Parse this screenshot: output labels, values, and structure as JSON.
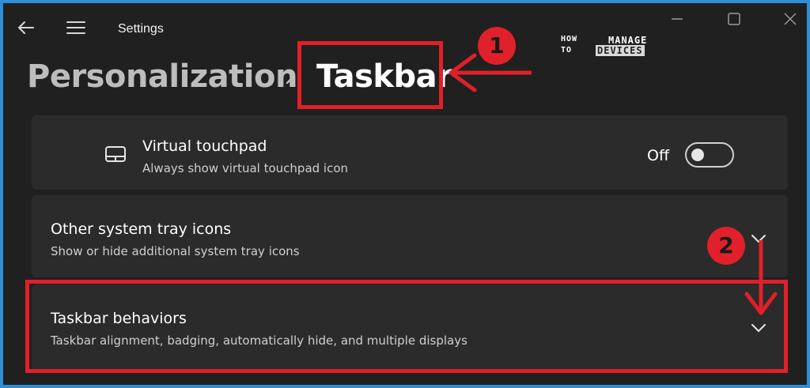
{
  "window": {
    "app_title": "Settings",
    "controls": [
      "minimize-icon",
      "maximize-icon",
      "close-icon"
    ]
  },
  "logo": {
    "how": "HOW",
    "to": "TO",
    "manage": "MANAGE",
    "devices": "DEVICES"
  },
  "breadcrumb": {
    "parent": "Personalization",
    "separator_icon": "chevron-right-icon",
    "current": "Taskbar"
  },
  "cards": {
    "virtual_touchpad": {
      "icon": "touchpad-icon",
      "title": "Virtual touchpad",
      "subtitle": "Always show virtual touchpad icon",
      "toggle_label": "Off",
      "toggle_on": false
    },
    "other_tray_icons": {
      "title": "Other system tray icons",
      "subtitle": "Show or hide additional system tray icons",
      "expand_icon": "chevron-down-icon"
    },
    "taskbar_behaviors": {
      "title": "Taskbar behaviors",
      "subtitle": "Taskbar alignment, badging, automatically hide, and multiple displays",
      "expand_icon": "chevron-down-icon"
    }
  },
  "annotations": {
    "step1": "1",
    "step2": "2",
    "color": "#e0202a"
  },
  "colors": {
    "window_bg": "#202020",
    "card_bg": "#2b2b2b",
    "frame": "#2e8fd6"
  }
}
